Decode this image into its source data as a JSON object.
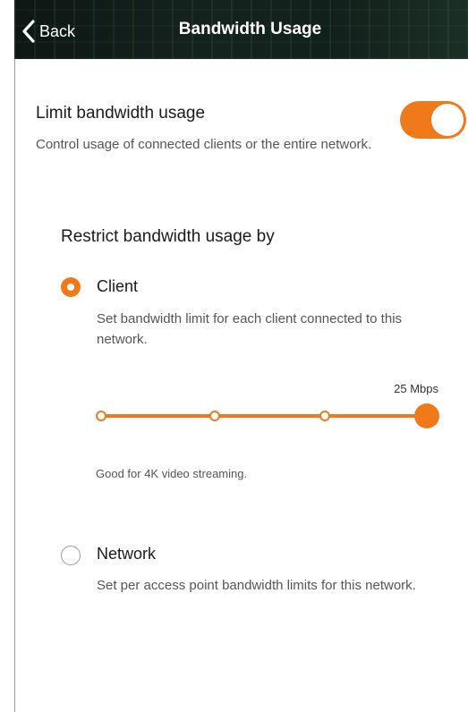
{
  "header": {
    "back_label": "Back",
    "title": "Bandwidth Usage"
  },
  "limit": {
    "title": "Limit bandwidth usage",
    "description": "Control usage of connected clients or the entire network.",
    "enabled": true
  },
  "restrict": {
    "title": "Restrict bandwidth usage by",
    "selected": "client",
    "options": [
      {
        "label": "Client",
        "description": "Set bandwidth limit for each client connected to this network.",
        "checked": true
      },
      {
        "label": "Network",
        "description": "Set per access point bandwidth limits for this network.",
        "checked": false
      }
    ]
  },
  "slider": {
    "value_label": "25 Mbps",
    "steps": 4,
    "selected_step": 4,
    "hint": "Good for 4K video streaming."
  },
  "colors": {
    "accent": "#f07a1a",
    "header_bg": "#12201b"
  }
}
